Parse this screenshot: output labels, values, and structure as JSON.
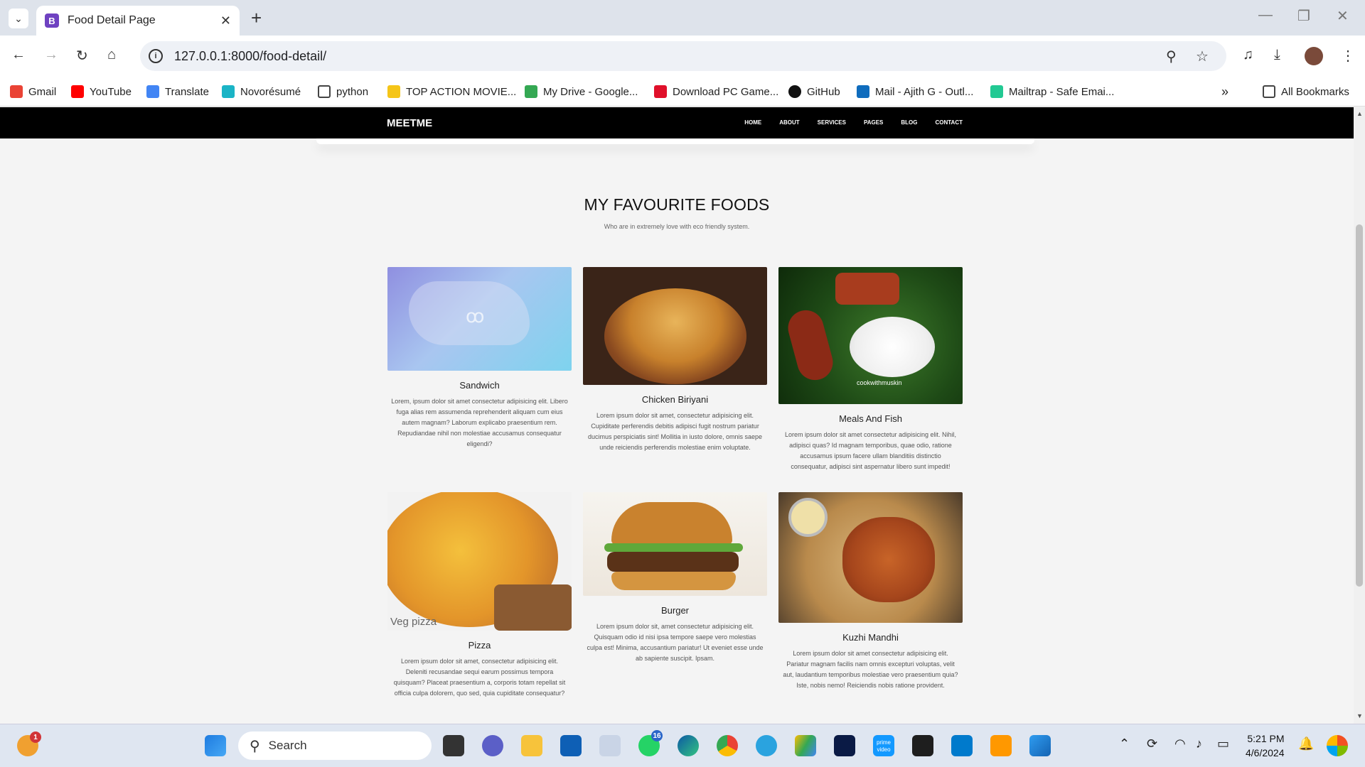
{
  "browser": {
    "tab_title": "Food Detail Page",
    "tab_favicon": "B",
    "url": "127.0.0.1:8000/food-detail/",
    "bookmarks": [
      {
        "label": "Gmail",
        "color": "#ea4335"
      },
      {
        "label": "YouTube",
        "color": "#ff0000"
      },
      {
        "label": "Translate",
        "color": "#4285f4"
      },
      {
        "label": "Novorésumé",
        "color": "#1bb4c6"
      },
      {
        "label": "python",
        "color": "folder"
      },
      {
        "label": "TOP ACTION MOVIE...",
        "color": "#f5c518"
      },
      {
        "label": "My Drive - Google...",
        "color": "#34a853"
      },
      {
        "label": "Download PC Game...",
        "color": "#e0102a"
      },
      {
        "label": "GitHub",
        "color": "#111111"
      },
      {
        "label": "Mail - Ajith G - Outl...",
        "color": "#0f6cbd"
      },
      {
        "label": "Mailtrap - Safe Emai...",
        "color": "#22c993"
      }
    ],
    "all_bookmarks": "All Bookmarks"
  },
  "site": {
    "brand": "MEETME",
    "nav": [
      "HOME",
      "ABOUT",
      "SERVICES",
      "PAGES",
      "BLOG",
      "CONTACT"
    ],
    "section_title": "MY FAVOURITE FOODS",
    "section_subtitle": "Who are in extremely love with eco friendly system.",
    "foods": [
      {
        "name": "Sandwich",
        "desc": "Lorem, ipsum dolor sit amet consectetur adipisicing elit. Libero fuga alias rem assumenda reprehenderit aliquam cum eius autem magnam? Laborum explicabo praesentium rem. Repudiandae nihil non molestiae accusamus consequatur eligendi?"
      },
      {
        "name": "Chicken Biriyani",
        "desc": "Lorem ipsum dolor sit amet, consectetur adipisicing elit. Cupiditate perferendis debitis adipisci fugit nostrum pariatur ducimus perspiciatis sint! Mollitia in iusto dolore, omnis saepe unde reiciendis perferendis molestiae enim voluptate."
      },
      {
        "name": "Meals And Fish",
        "desc": "Lorem ipsum dolor sit amet consectetur adipisicing elit. Nihil, adipisci quas? Id magnam temporibus, quae odio, ratione accusamus ipsum facere ullam blanditiis distinctio consequatur, adipisci sint aspernatur libero sunt impedit!",
        "watermark": "cookwithmuskin"
      },
      {
        "name": "Pizza",
        "desc": "Lorem ipsum dolor sit amet, consectetur adipisicing elit. Deleniti recusandae sequi earum possimus tempora quisquam? Placeat praesentium a, corporis totam repellat sit officia culpa dolorem, quo sed, quia cupiditate consequatur?",
        "caption": "Veg pizza"
      },
      {
        "name": "Burger",
        "desc": "Lorem ipsum dolor sit, amet consectetur adipisicing elit. Quisquam odio id nisi ipsa tempore saepe vero molestias culpa est! Minima, accusantium pariatur! Ut eveniet esse unde ab sapiente suscipit. Ipsam."
      },
      {
        "name": "Kuzhi Mandhi",
        "desc": "Lorem ipsum dolor sit amet consectetur adipisicing elit. Pariatur magnam facilis nam omnis excepturi voluptas, velit aut, laudantium temporibus molestiae vero praesentium quia? Iste, nobis nemo! Reiciendis nobis ratione provident."
      }
    ]
  },
  "taskbar": {
    "search_placeholder": "Search",
    "time": "5:21 PM",
    "date": "4/6/2024",
    "whatsapp_badge": "16",
    "widget_badge": "1",
    "prime_label": "prime video"
  }
}
